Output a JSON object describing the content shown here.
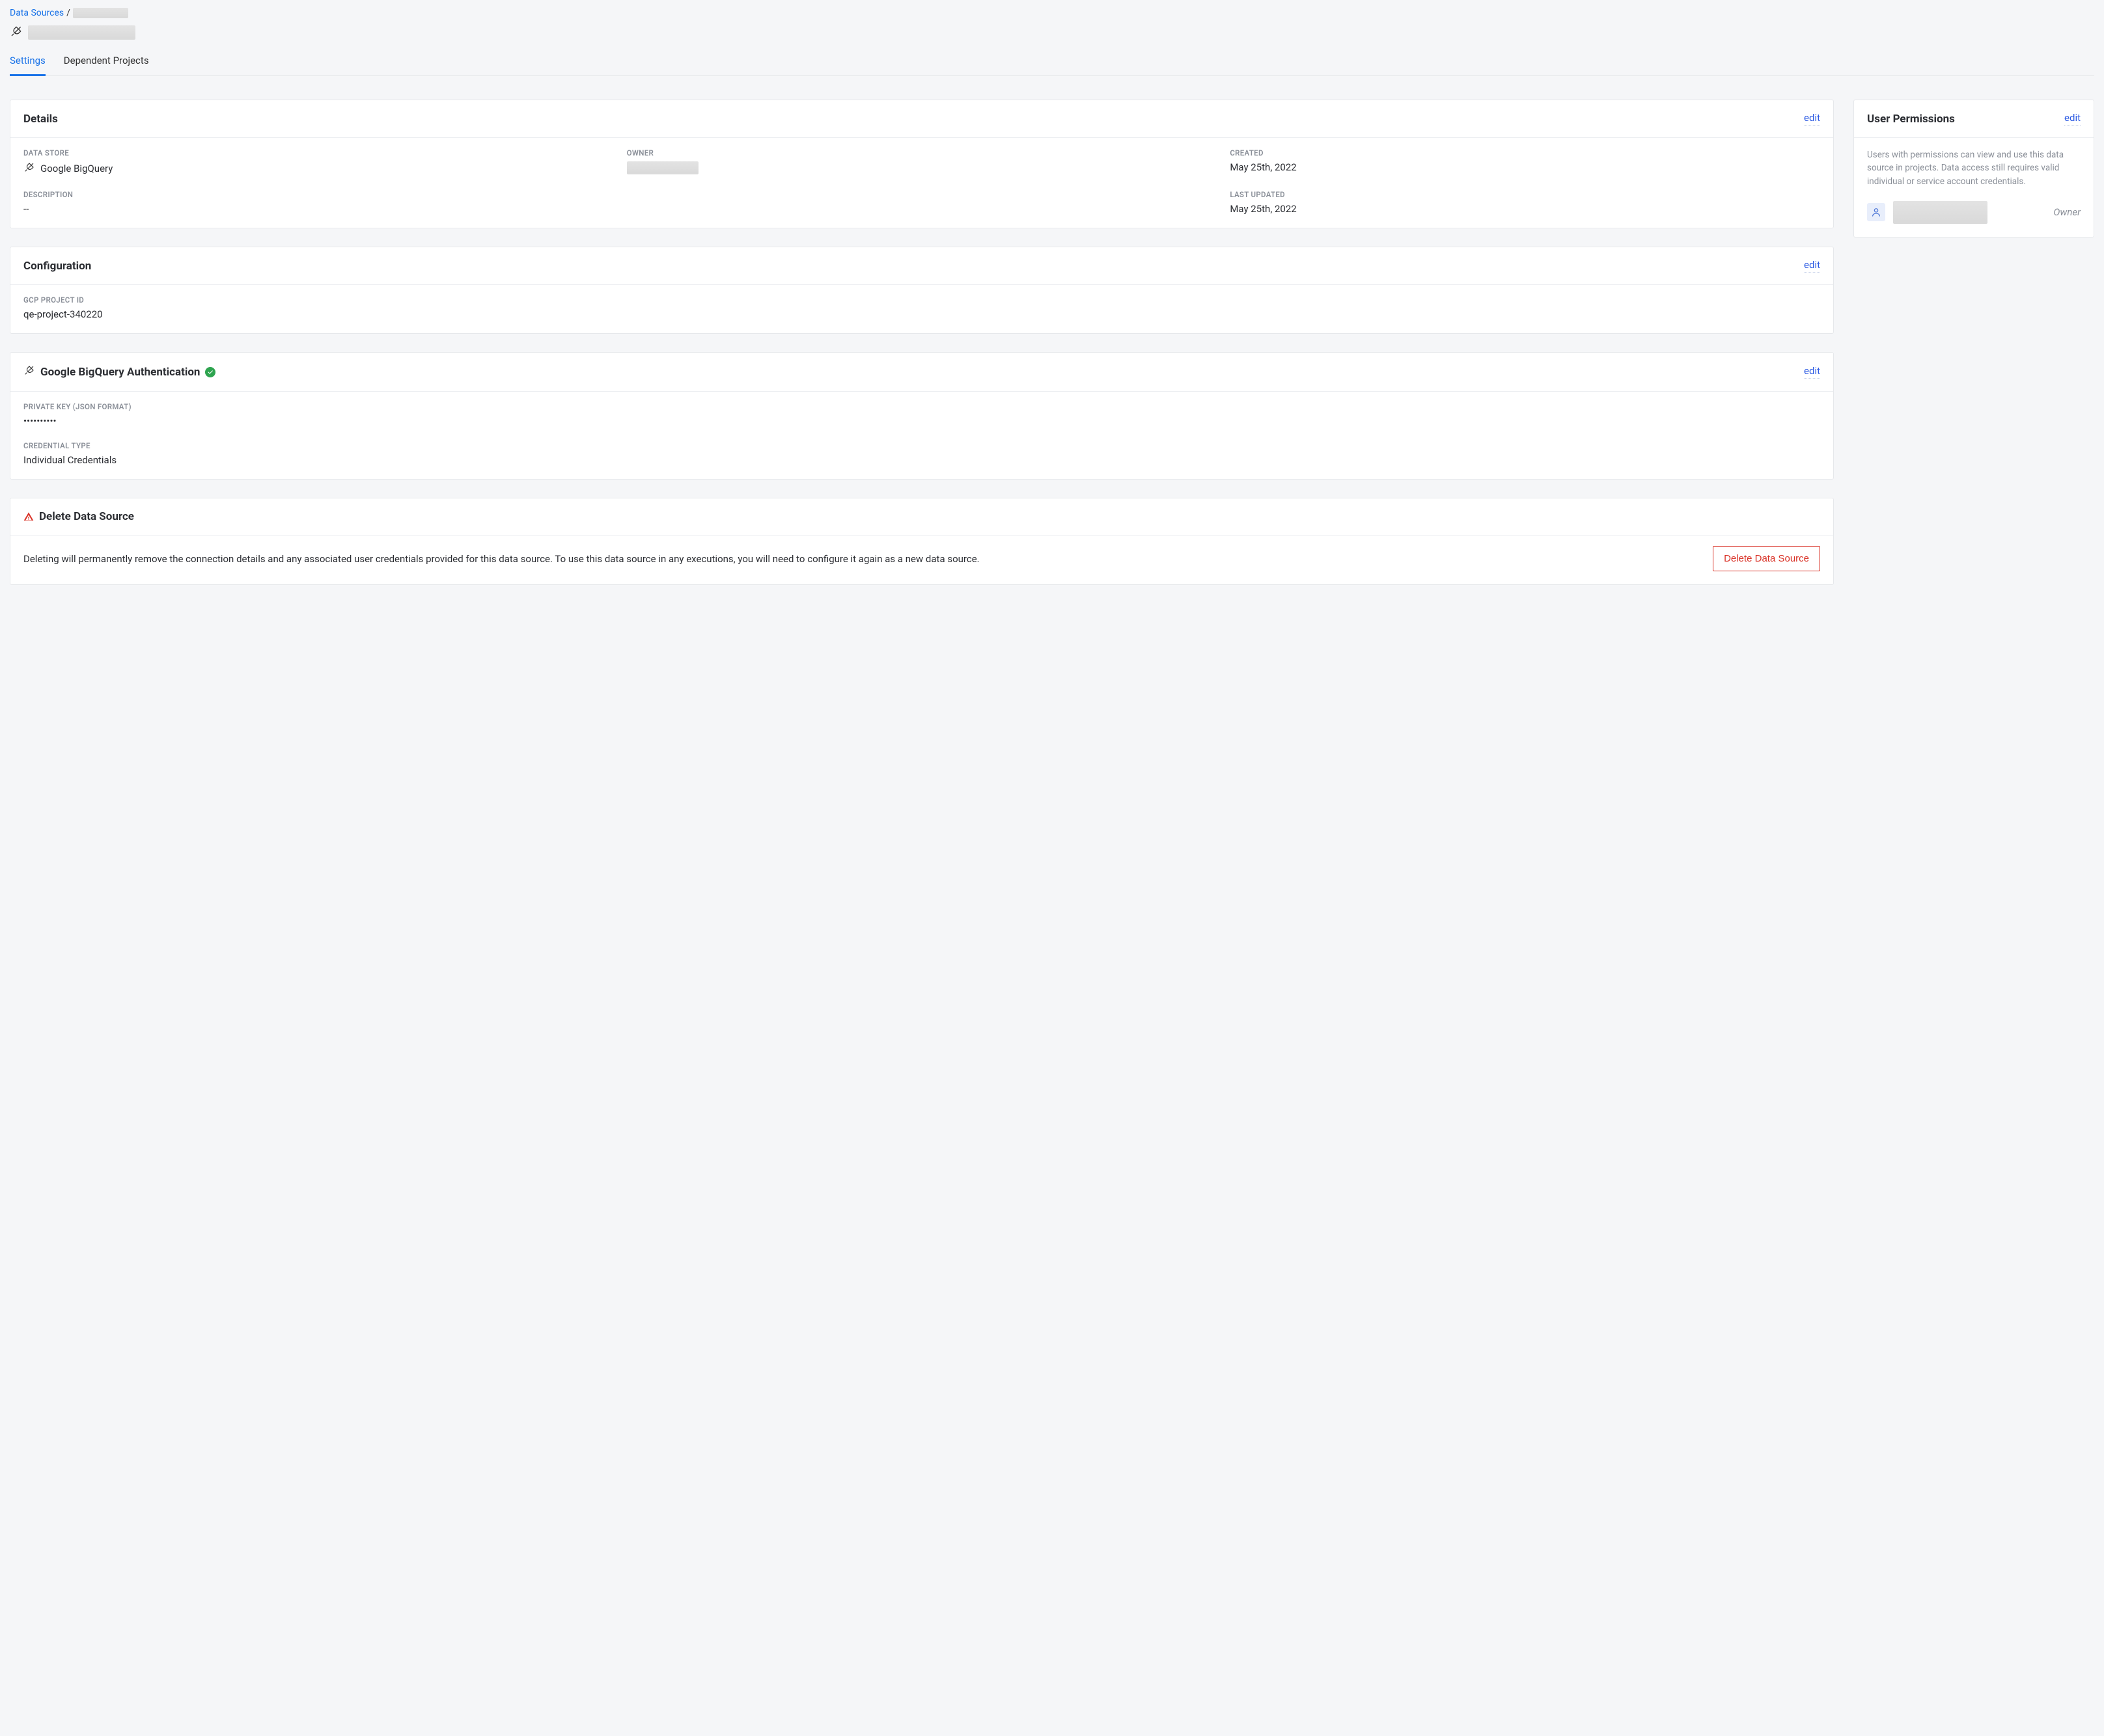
{
  "breadcrumb": {
    "root": "Data Sources",
    "sep": "/"
  },
  "tabs": {
    "settings": "Settings",
    "dependent": "Dependent Projects"
  },
  "details": {
    "title": "Details",
    "edit": "edit",
    "data_store_label": "DATA STORE",
    "data_store_value": "Google BigQuery",
    "owner_label": "OWNER",
    "created_label": "CREATED",
    "created_value": "May 25th, 2022",
    "description_label": "DESCRIPTION",
    "description_value": "--",
    "last_updated_label": "LAST UPDATED",
    "last_updated_value": "May 25th, 2022"
  },
  "configuration": {
    "title": "Configuration",
    "edit": "edit",
    "gcp_project_id_label": "GCP PROJECT ID",
    "gcp_project_id_value": "qe-project-340220"
  },
  "auth": {
    "title": "Google BigQuery Authentication",
    "edit": "edit",
    "private_key_label": "PRIVATE KEY (JSON FORMAT)",
    "private_key_value": "••••••••••",
    "credential_type_label": "CREDENTIAL TYPE",
    "credential_type_value": "Individual Credentials"
  },
  "delete": {
    "title": "Delete Data Source",
    "description": "Deleting will permanently remove the connection details and any associated user credentials provided for this data source. To use this data source in any executions, you will need to configure it again as a new data source.",
    "button": "Delete Data Source"
  },
  "permissions": {
    "title": "User Permissions",
    "edit": "edit",
    "description": "Users with permissions can view and use this data source in projects. Data access still requires valid individual or service account credentials.",
    "role": "Owner"
  }
}
